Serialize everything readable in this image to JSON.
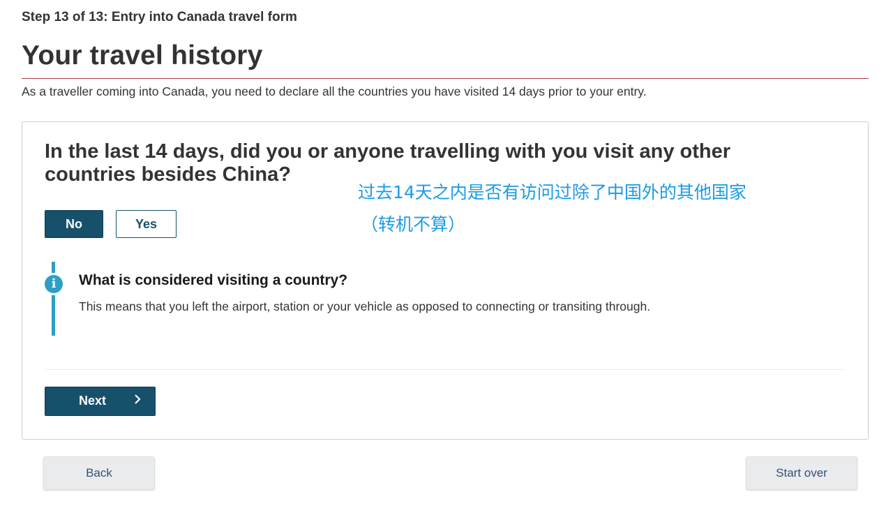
{
  "header": {
    "step": "Step 13 of 13: Entry into Canada travel form",
    "title": "Your travel history",
    "intro": "As a traveller coming into Canada, you need to declare all the countries you have visited 14 days prior to your entry."
  },
  "question": {
    "text": "In the last 14 days, did you or anyone travelling with you visit any other countries besides China?",
    "options": [
      {
        "label": "No",
        "selected": true
      },
      {
        "label": "Yes",
        "selected": false
      }
    ]
  },
  "annotation": {
    "line1": "过去14天之内是否有访问过除了中国外的其他国家",
    "line2": "（转机不算）",
    "color": "#1a9be6"
  },
  "info": {
    "icon": "info-icon",
    "heading": "What is considered visiting a country?",
    "text": "This means that you left the airport, station or your vehicle as opposed to connecting or transiting through."
  },
  "actions": {
    "next_label": "Next",
    "next_icon": "chevron-right-icon",
    "back_label": "Back",
    "start_over_label": "Start over"
  },
  "colors": {
    "primary": "#17506b",
    "accent_rule": "#af3c43",
    "info_blue": "#2d9fc4"
  }
}
